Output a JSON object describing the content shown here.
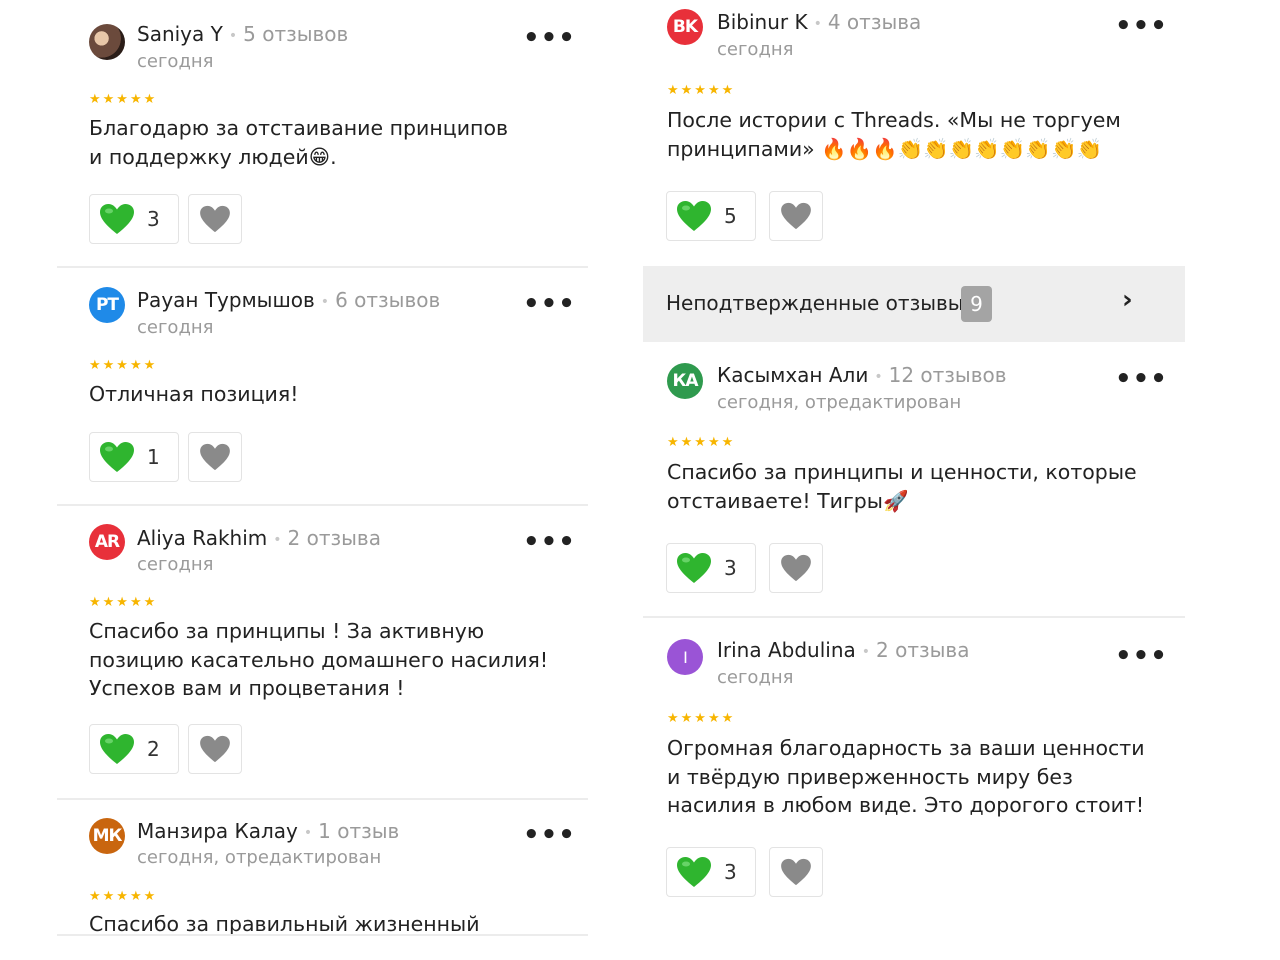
{
  "colors": {
    "liked_heart": "#2fb52f",
    "dislike_heart": "#8a8a8a",
    "stars": "#f7b500",
    "secondary_text": "#9a9a9a",
    "badge_bg": "#a4a4a4",
    "banner_bg": "#eeeeee"
  },
  "icons": {
    "liked": "green-heart-icon",
    "dislike": "gray-heart-icon",
    "more": "more-dots-icon",
    "chevron": "chevron-right-icon"
  },
  "left_reviews": [
    {
      "avatar_initials": "",
      "avatar_color": "#6b4a3c",
      "author": "Saniya Y",
      "review_count": "5 отзывов",
      "date": "сегодня",
      "rating": 5,
      "stars": "★★★★★",
      "text": "Благодарю за отстаивание принципов и поддержку людей😁.",
      "likes": "3",
      "more": "•••"
    },
    {
      "avatar_initials": "РТ",
      "avatar_color": "#1f8ae8",
      "author": "Раyан Турмышов",
      "review_count": "6 отзывов",
      "date": "сегодня",
      "rating": 5,
      "stars": "★★★★★",
      "text": "Отличная позиция!",
      "likes": "1",
      "more": "•••"
    },
    {
      "avatar_initials": "AR",
      "avatar_color": "#e8303a",
      "author": "Aliya Rakhim",
      "review_count": "2 отзыва",
      "date": "сегодня",
      "rating": 5,
      "stars": "★★★★★",
      "text": "Спасибо за принципы ! За активную позицию касательно домашнего насилия! Успехов вам и процветания !",
      "likes": "2",
      "more": "•••"
    },
    {
      "avatar_initials": "МК",
      "avatar_color": "#c9660f",
      "author": "Манзира Калау",
      "review_count": "1 отзыв",
      "date": "сегодня, отредактирован",
      "rating": 5,
      "stars": "★★★★★",
      "text": "Спасибо за правильный жизненный принцип",
      "likes": "",
      "more": "•••"
    }
  ],
  "right_reviews": [
    {
      "avatar_initials": "BK",
      "avatar_color": "#e8303a",
      "author": "Bibinur K",
      "review_count": "4 отзыва",
      "date": "сегодня",
      "rating": 5,
      "stars": "★★★★★",
      "text": "После истории с Threads. «Мы не торгуем принципами» 🔥🔥🔥👏👏👏👏👏👏👏👏",
      "likes": "5",
      "more": "•••"
    },
    {
      "avatar_initials": "КА",
      "avatar_color": "#2f9a4e",
      "author": "Касымхан Али",
      "review_count": "12 отзывов",
      "date": "сегодня, отредактирован",
      "rating": 5,
      "stars": "★★★★★",
      "text": "Спасибо за принципы и ценности, которые отстаиваете! Тигры🚀",
      "likes": "3",
      "more": "•••"
    },
    {
      "avatar_initials": "I",
      "avatar_color": "#9a54d6",
      "author": "Irina Abdulina",
      "review_count": "2 отзыва",
      "date": "сегодня",
      "rating": 5,
      "stars": "★★★★★",
      "text": "Огромная благодарность за ваши ценности и твёрдую приверженность миру без насилия в любом виде. Это дорогого стоит!",
      "likes": "3",
      "more": "•••"
    }
  ],
  "unverified_banner": {
    "label": "Неподтвержденные отзывы",
    "count": "9",
    "chevron": "›"
  }
}
